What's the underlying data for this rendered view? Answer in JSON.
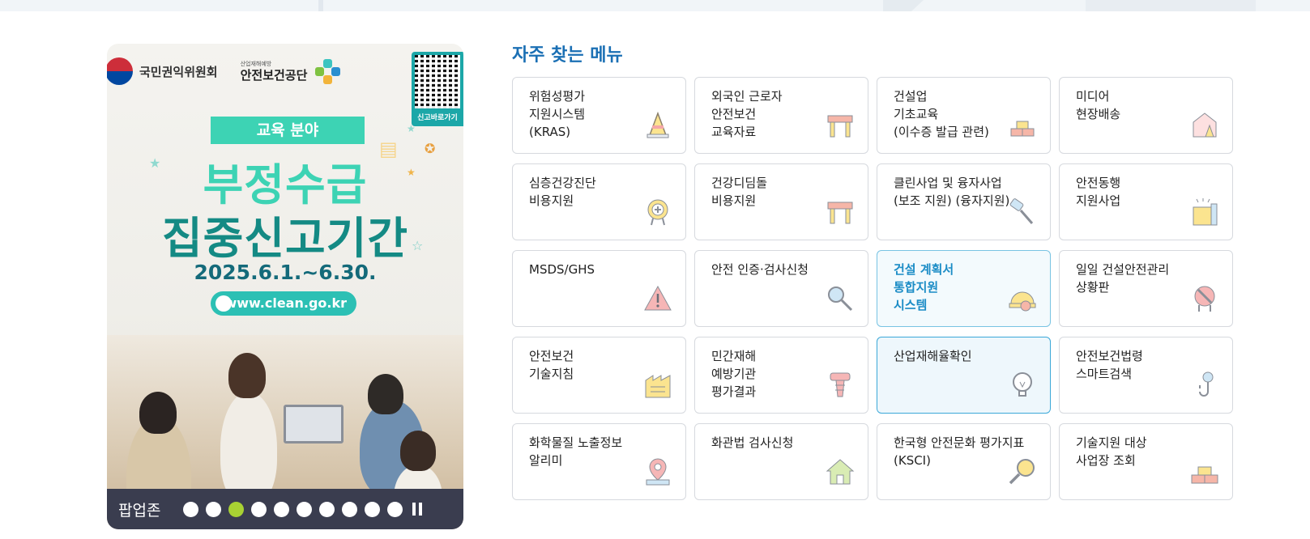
{
  "popup": {
    "org_name_1": "국민권익위원회",
    "org_name_2_small": "산업재해예방",
    "org_name_2": "안전보건공단",
    "qr_label": "신고바로가기",
    "ribbon": "교육 분야",
    "headline_1": "부정수급",
    "headline_2": "집중신고기간",
    "period": "2025.6.1.~6.30.",
    "url": "www.clean.go.kr",
    "bar_label": "팝업존",
    "slide_count": 10,
    "active_slide": 3
  },
  "menu": {
    "title": "자주 찾는 메뉴",
    "items": [
      {
        "label": "위험성평가\n지원시스템\n(KRAS)",
        "icon": "traffic-cone-icon"
      },
      {
        "label": "외국인 근로자\n안전보건\n교육자료",
        "icon": "barrier-icon"
      },
      {
        "label": "건설업\n기초교육\n(이수증 발급 관련)",
        "icon": "bricks-icon"
      },
      {
        "label": "미디어\n현장배송",
        "icon": "house-cone-icon"
      },
      {
        "label": "심층건강진단\n비용지원",
        "icon": "medical-badge-icon"
      },
      {
        "label": "건강디딤돌\n비용지원",
        "icon": "barrier-icon"
      },
      {
        "label": "클린사업 및 융자사업\n(보조 지원) (융자지원)",
        "icon": "drill-icon"
      },
      {
        "label": "안전동행\n지원사업",
        "icon": "building-icon"
      },
      {
        "label": "MSDS/GHS",
        "icon": "warning-icon"
      },
      {
        "label": "안전 인증·검사신청",
        "icon": "wrench-search-icon"
      },
      {
        "label": "건설 계획서\n통합지원\n시스템",
        "icon": "hardhat-icon"
      },
      {
        "label": "일일 건설안전관리\n상황판",
        "icon": "no-entry-sign-icon"
      },
      {
        "label": "안전보건\n기술지침",
        "icon": "factory-icon"
      },
      {
        "label": "민간재해\n예방기관\n평가결과",
        "icon": "screw-icon"
      },
      {
        "label": "산업재해율확인",
        "icon": "lightbulb-icon"
      },
      {
        "label": "안전보건법령\n스마트검색",
        "icon": "crane-hook-icon"
      },
      {
        "label": "화학물질 노출정보\n알리미",
        "icon": "map-pin-icon"
      },
      {
        "label": "화관법 검사신청",
        "icon": "home-icon"
      },
      {
        "label": "한국형 안전문화 평가지표\n(KSCI)",
        "icon": "magnifier-icon"
      },
      {
        "label": "기술지원 대상\n사업장 조회",
        "icon": "bricks-icon"
      }
    ]
  },
  "colors": {
    "accent": "#1a6fb4",
    "highlight_text": "#1b8cc6",
    "active_dot": "#a8d233",
    "popup_bar": "#3a3d4f"
  }
}
